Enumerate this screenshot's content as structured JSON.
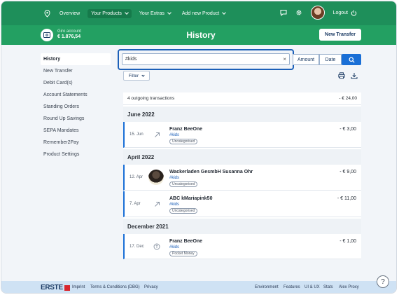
{
  "topnav": {
    "overview": "Overview",
    "your_products": "Your Products",
    "your_extras": "Your Extras",
    "add_new_product": "Add new Product",
    "logout": "Logout",
    "icons": [
      "location-pin-icon",
      "chat-icon",
      "gear-icon",
      "avatar",
      "power-icon"
    ]
  },
  "header": {
    "account_name": "Giro account",
    "account_balance": "€ 1.876,54",
    "title": "History",
    "new_transfer": "New Transfer"
  },
  "sidebar": {
    "items": [
      {
        "label": "History",
        "active": true
      },
      {
        "label": "New Transfer"
      },
      {
        "label": "Debit Card(s)"
      },
      {
        "label": "Account Statements"
      },
      {
        "label": "Standing Orders"
      },
      {
        "label": "Round Up Savings"
      },
      {
        "label": "SEPA Mandates"
      },
      {
        "label": "Remember2Pay"
      },
      {
        "label": "Product Settings"
      }
    ]
  },
  "search": {
    "value": "#kids",
    "clear": "×",
    "amount_btn": "Amount",
    "date_btn": "Date",
    "filter_label": "Filter"
  },
  "list": {
    "summary_label": "4 outgoing transactions",
    "summary_total": "- € 24,00",
    "months": [
      {
        "label": "June 2022"
      },
      {
        "label": "April 2022"
      },
      {
        "label": "December 2021"
      }
    ],
    "transactions": [
      {
        "date": "15. Jun",
        "name": "Franz BeeOne",
        "tag": "#kids",
        "category": "Uncategorised",
        "amount": "- € 3,00",
        "icon": "arrow-up-right-icon"
      },
      {
        "date": "12. Apr",
        "name": "Wackerladen GesmbH Susanna Ohr",
        "tag": "#kids",
        "category": "Uncategorised",
        "amount": "- € 9,00",
        "icon": "merchant-photo"
      },
      {
        "date": "7. Apr",
        "name": "ABC kMariapink50",
        "tag": "#kids",
        "category": "Uncategorised",
        "amount": "- € 11,00",
        "icon": "arrow-up-right-icon"
      },
      {
        "date": "17. Dec",
        "name": "Franz BeeOne",
        "tag": "#kids",
        "category": "Pocket Money",
        "amount": "- € 1,00",
        "icon": "pocket-money-icon"
      }
    ]
  },
  "footer": {
    "brand": "ERSTE",
    "imprint": "Imprint",
    "terms": "Terms & Conditions (DBG)",
    "privacy": "Privacy",
    "environment": "Environment",
    "features": "Features",
    "ui_ux": "UI & UX",
    "stats": "Stats",
    "alex_proxy": "Alex Proxy",
    "help": "?"
  },
  "colors": {
    "nav_green": "#1e8f5a",
    "header_green": "#23a062",
    "accent_blue": "#1a6fd6",
    "footer_blue": "#cfe2f4"
  }
}
